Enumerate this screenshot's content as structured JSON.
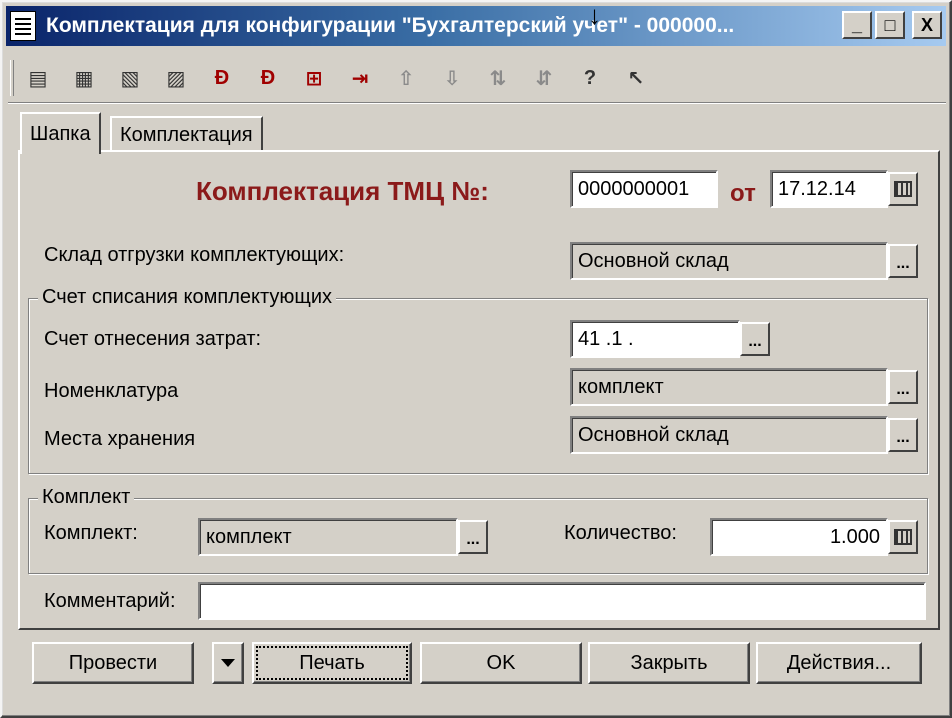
{
  "window": {
    "title": "Комплектация для конфигурации \"Бухгалтерский учет\" - 000000...",
    "controls": [
      "_",
      "□",
      "X"
    ]
  },
  "toolbar": {
    "icons": [
      "new-row-icon",
      "add-row-icon",
      "delete-row-icon",
      "edit-row-icon",
      "dt-kt-icon",
      "dt-kt-red-icon",
      "insert-icon",
      "move-icon",
      "move-up-icon",
      "move-down-icon",
      "sort-asc-icon",
      "sort-desc-icon",
      "help-icon",
      "context-help-icon"
    ]
  },
  "tabs": [
    "Шапка",
    "Комплектация"
  ],
  "header": {
    "doc_title": "Комплектация ТМЦ №:",
    "doc_number": "0000000001",
    "date_label": "от",
    "date": "17.12.14"
  },
  "warehouse": {
    "label": "Склад отгрузки комплектующих:",
    "value": "Основной склад"
  },
  "writeoff_group": {
    "title": "Счет списания комплектующих",
    "cost_account_label": "Счет отнесения затрат:",
    "cost_account_value": "41 .1 .",
    "nomenclature_label": "Номенклатура",
    "nomenclature_value": "комплект",
    "storage_label": "Места хранения",
    "storage_value": "Основной склад"
  },
  "kit_group": {
    "title": "Комплект",
    "kit_label": "Комплект:",
    "kit_value": "комплект",
    "qty_label": "Количество:",
    "qty_value": "1.000"
  },
  "comment": {
    "label": "Комментарий:",
    "value": ""
  },
  "buttons": {
    "post": "Провести",
    "print": "Печать",
    "ok": "OK",
    "close": "Закрыть",
    "actions": "Действия..."
  },
  "ellipsis": "..."
}
